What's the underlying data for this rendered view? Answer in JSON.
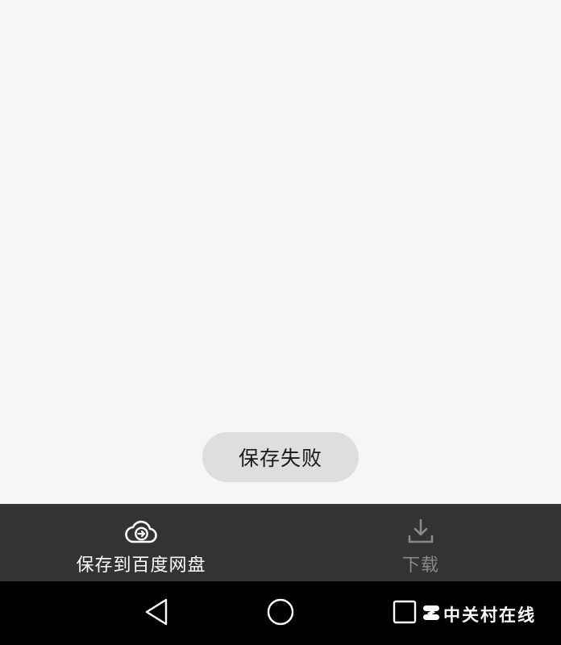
{
  "toast": {
    "message": "保存失败"
  },
  "bottom_bar": {
    "save": {
      "label": "保存到百度网盘",
      "icon": "cloud-upload-icon"
    },
    "download": {
      "label": "下载",
      "icon": "download-icon"
    }
  },
  "nav_bar": {
    "back_icon": "back-triangle-icon",
    "home_icon": "home-circle-icon",
    "recent_icon": "recent-square-icon"
  },
  "watermark": {
    "text": "中关村在线",
    "logo": "zol-logo-icon"
  },
  "colors": {
    "background": "#f5f6f8",
    "toast_bg": "#dedee0",
    "bottom_bar_bg": "#333333",
    "nav_bar_bg": "#000000",
    "active_label": "#ffffff",
    "inactive_label": "#8a8a8a"
  }
}
